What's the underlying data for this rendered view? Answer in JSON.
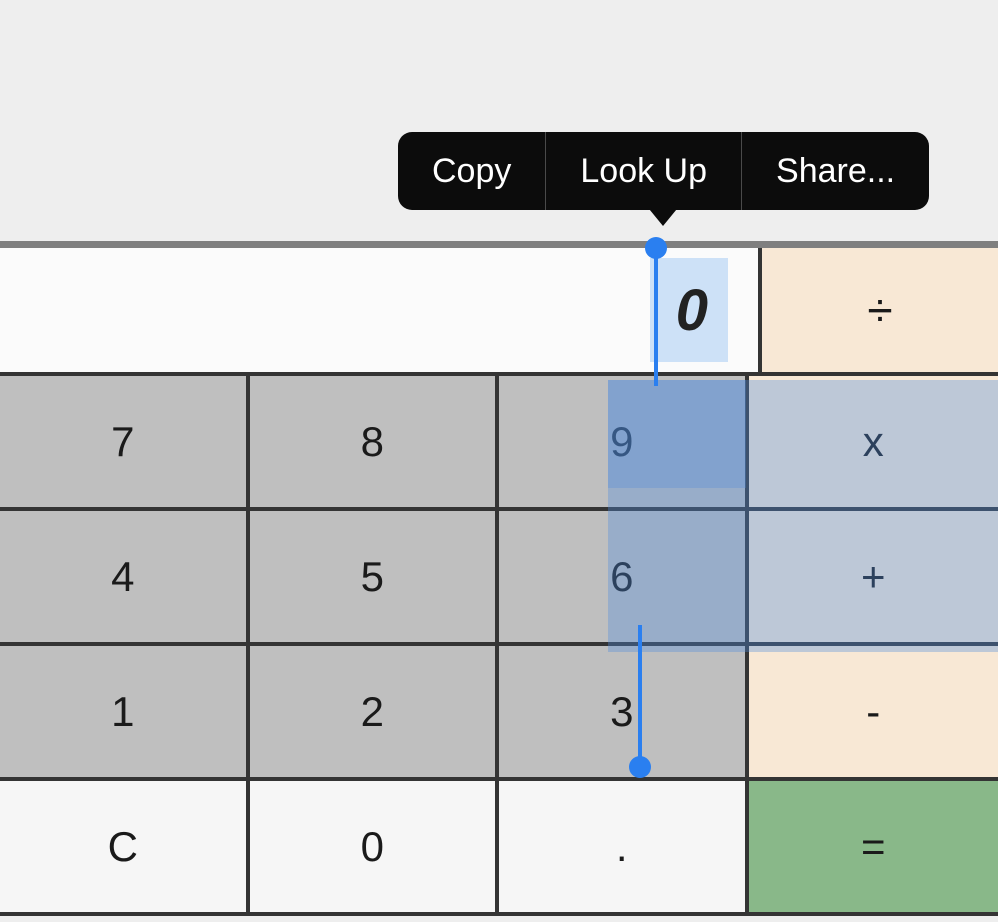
{
  "display": {
    "value": "0"
  },
  "contextMenu": {
    "items": [
      {
        "label": "Copy"
      },
      {
        "label": "Look Up"
      },
      {
        "label": "Share..."
      }
    ]
  },
  "keys": {
    "divide": "÷",
    "multiply": "x",
    "plus": "+",
    "minus": "-",
    "equals": "=",
    "seven": "7",
    "eight": "8",
    "nine": "9",
    "four": "4",
    "five": "5",
    "six": "6",
    "one": "1",
    "two": "2",
    "three": "3",
    "clear": "C",
    "zero": "0",
    "decimal": "."
  }
}
